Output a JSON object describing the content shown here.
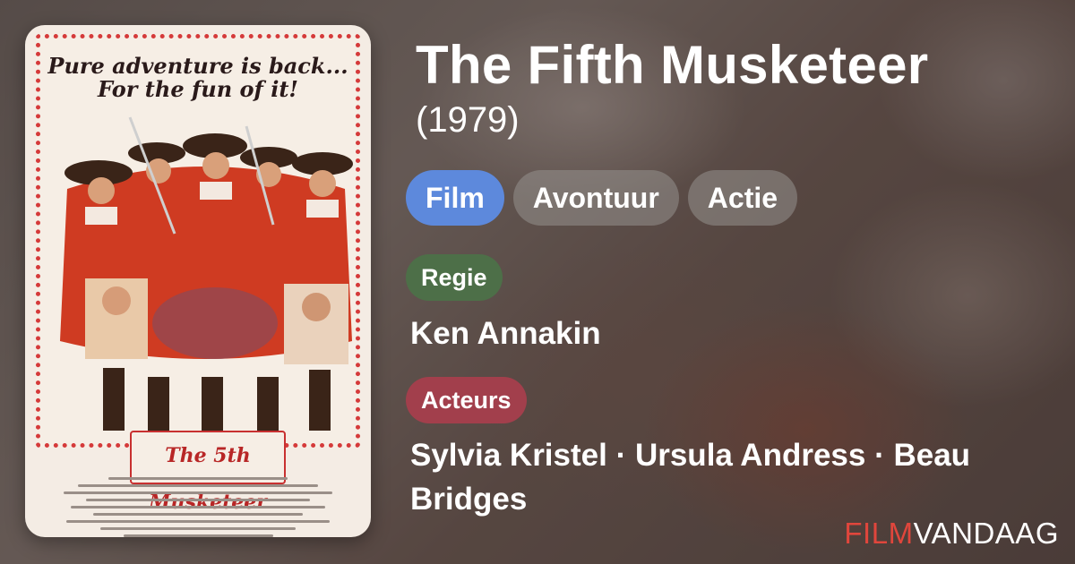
{
  "movie": {
    "title": "The Fifth Musketeer",
    "year": "(1979)"
  },
  "genres": [
    "Film",
    "Avontuur",
    "Actie"
  ],
  "director": {
    "label": "Regie",
    "name": "Ken Annakin"
  },
  "cast": {
    "label": "Acteurs",
    "names": "Sylvia Kristel · Ursula Andress · Beau Bridges"
  },
  "poster": {
    "tagline_line1": "Pure adventure is back...",
    "tagline_line2": "For the fun of it!",
    "film_logo": "The 5th Musketeer"
  },
  "brand": {
    "part1": "FILM",
    "part2": "VANDAAG"
  },
  "colors": {
    "genre_primary": "#5d89dc",
    "regie_badge": "#4d6f48",
    "acteurs_badge": "#a23f4c",
    "brand_accent": "#e0463c"
  }
}
